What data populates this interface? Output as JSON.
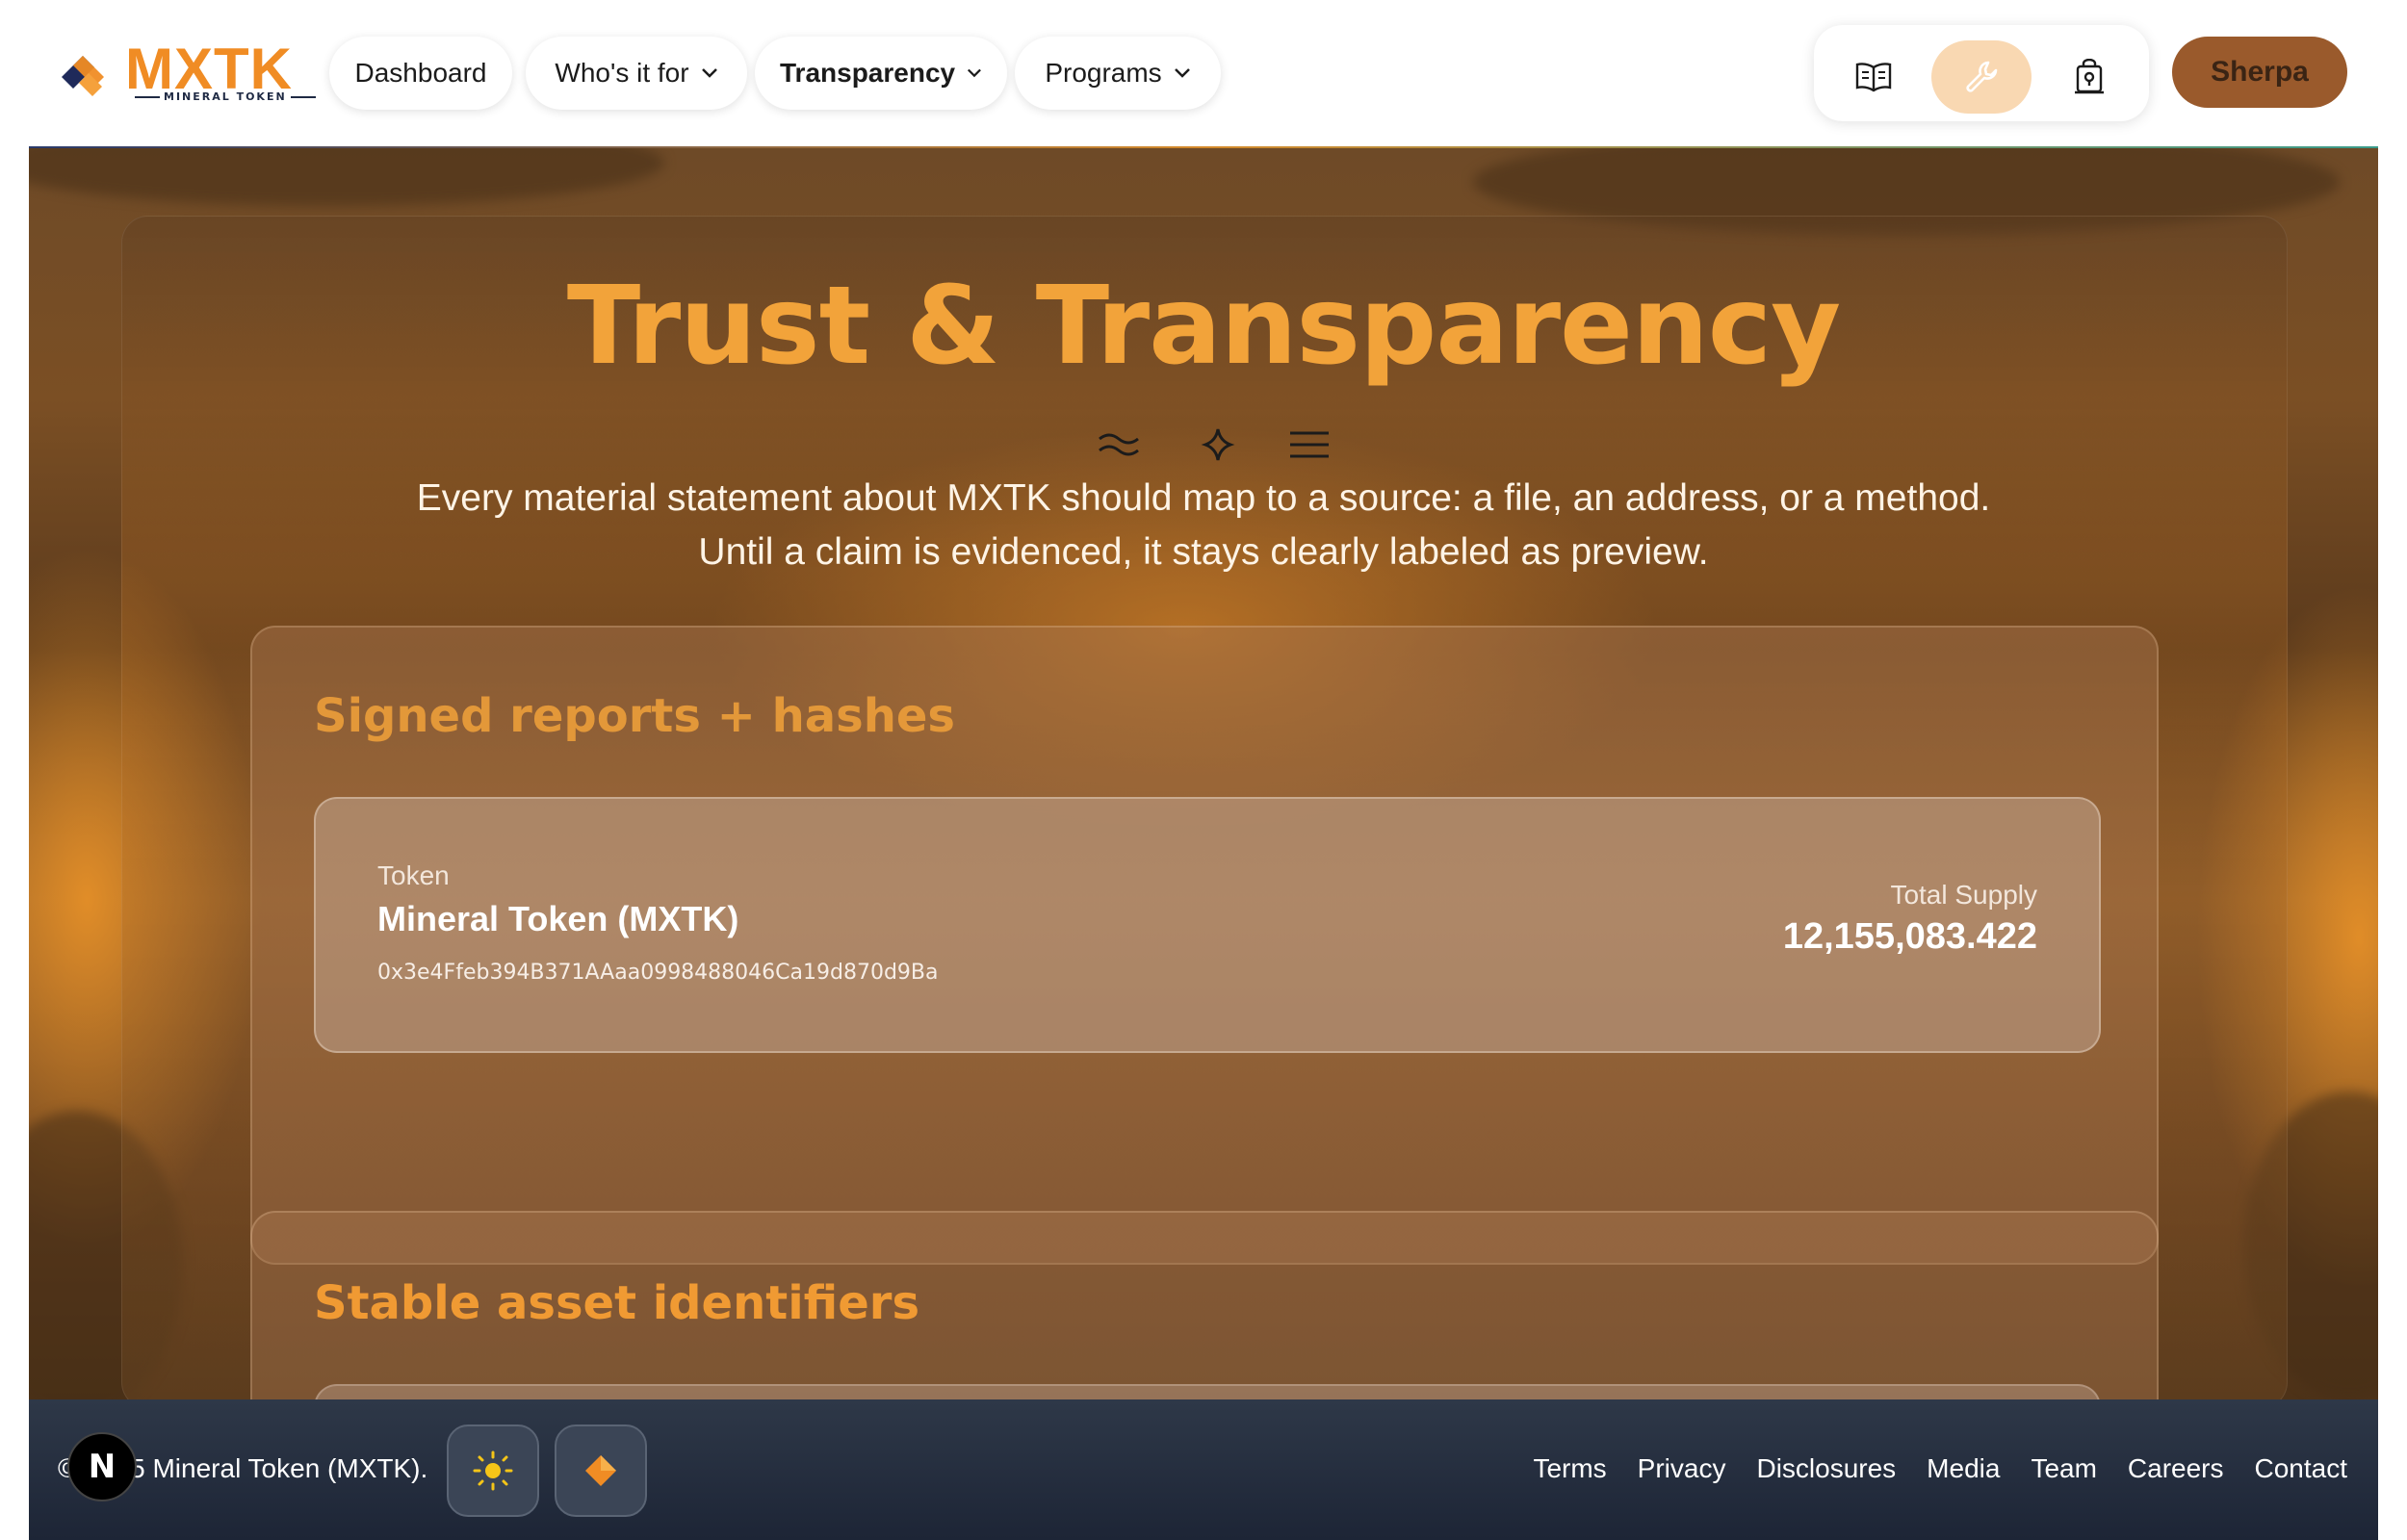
{
  "brand": {
    "name": "MXTK",
    "tagline": "MINERAL TOKEN"
  },
  "nav": {
    "items": [
      {
        "label": "Dashboard",
        "has_menu": false,
        "active": false
      },
      {
        "label": "Who's it for",
        "has_menu": true,
        "active": false
      },
      {
        "label": "Transparency",
        "has_menu": true,
        "active": true
      },
      {
        "label": "Programs",
        "has_menu": true,
        "active": false
      }
    ],
    "tools": [
      {
        "icon": "book-open-icon",
        "active": false
      },
      {
        "icon": "wrench-icon",
        "active": true
      },
      {
        "icon": "vault-icon",
        "active": false
      }
    ],
    "cta_label": "Sherpa"
  },
  "hero": {
    "title": "Trust & Transparency",
    "lead": "Every material statement about MXTK should map to a source: a file, an address, or a method. Until a claim is evidenced, it stays clearly labeled as preview."
  },
  "sections": [
    {
      "title": "Signed reports + hashes",
      "token": {
        "label": "Token",
        "name": "Mineral Token (MXTK)",
        "address": "0x3e4Ffeb394B371AAaa0998488046Ca19d870d9Ba",
        "supply_label": "Total Supply",
        "supply_value": "12,155,083.422"
      }
    },
    {
      "title": "Stable asset identifiers"
    }
  ],
  "footer": {
    "copyright": "© 2025 Mineral Token (MXTK).",
    "badge_letter": "N",
    "buttons": [
      "sun-icon",
      "diamond-icon"
    ],
    "links": [
      "Terms",
      "Privacy",
      "Disclosures",
      "Media",
      "Team",
      "Careers",
      "Contact"
    ]
  },
  "colors": {
    "accent": "#f2a33a",
    "cta": "#9a5a2c",
    "footer": "#1d2536",
    "active_tool": "#f9d8b2"
  }
}
